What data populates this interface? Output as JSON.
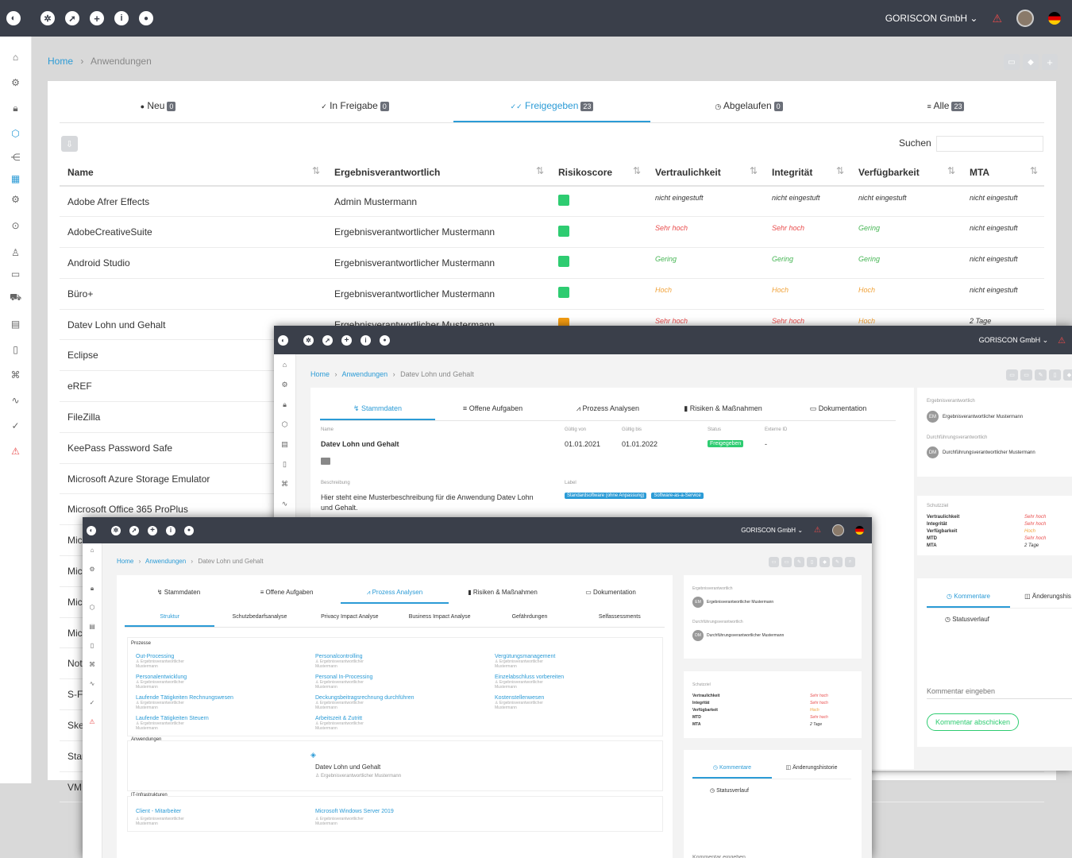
{
  "main": {
    "company": "GORISCON GmbH",
    "breadcrumb": {
      "home": "Home",
      "current": "Anwendungen"
    },
    "tabs": [
      {
        "label": "Neu",
        "count": "0"
      },
      {
        "label": "In Freigabe",
        "count": "0"
      },
      {
        "label": "Freigegeben",
        "count": "23"
      },
      {
        "label": "Abgelaufen",
        "count": "0"
      },
      {
        "label": "Alle",
        "count": "23"
      }
    ],
    "search_label": "Suchen",
    "columns": [
      "Name",
      "Ergebnisverantwortlich",
      "Risikoscore",
      "Vertraulichkeit",
      "Integrität",
      "Verfügbarkeit",
      "MTA"
    ],
    "rows": [
      {
        "name": "Adobe Afrer Effects",
        "owner": "Admin Mustermann",
        "risk": "#2ecc71",
        "v": "nicht eingestuft",
        "i": "nicht eingestuft",
        "a": "nicht eingestuft",
        "mta": "nicht eingestuft"
      },
      {
        "name": "AdobeCreativeSuite",
        "owner": "Ergebnisverantwortlicher Mustermann",
        "risk": "#2ecc71",
        "v": "Sehr hoch",
        "i": "Sehr hoch",
        "a": "Gering",
        "mta": "nicht eingestuft"
      },
      {
        "name": "Android Studio",
        "owner": "Ergebnisverantwortlicher Mustermann",
        "risk": "#2ecc71",
        "v": "Gering",
        "i": "Gering",
        "a": "Gering",
        "mta": "nicht eingestuft"
      },
      {
        "name": "Büro+",
        "owner": "Ergebnisverantwortlicher Mustermann",
        "risk": "#2ecc71",
        "v": "Hoch",
        "i": "Hoch",
        "a": "Hoch",
        "mta": "nicht eingestuft"
      },
      {
        "name": "Datev Lohn und Gehalt",
        "owner": "Ergebnisverantwortlicher Mustermann",
        "risk": "#f39c12",
        "v": "Sehr hoch",
        "i": "Sehr hoch",
        "a": "Hoch",
        "mta": "2 Tage"
      },
      {
        "name": "Eclipse"
      },
      {
        "name": "eREF"
      },
      {
        "name": "FileZilla"
      },
      {
        "name": "KeePass Password Safe"
      },
      {
        "name": "Microsoft Azure Storage Emulator"
      },
      {
        "name": "Microsoft Office 365 ProPlus"
      },
      {
        "name": "Mic"
      },
      {
        "name": "Mic"
      },
      {
        "name": "Mic"
      },
      {
        "name": "Mic"
      },
      {
        "name": "Not"
      },
      {
        "name": "S-F"
      },
      {
        "name": "Ske"
      },
      {
        "name": "Star"
      },
      {
        "name": "VM"
      }
    ],
    "footer_mta": "nicht eingestuft"
  },
  "detail": {
    "company": "GORISCON GmbH",
    "breadcrumb": {
      "home": "Home",
      "mid": "Anwendungen",
      "current": "Datev Lohn und Gehalt"
    },
    "tabs": [
      "Stammdaten",
      "Offene Aufgaben",
      "Prozess Analysen",
      "Risiken & Maßnahmen",
      "Dokumentation"
    ],
    "fields": {
      "name_label": "Name",
      "name": "Datev Lohn und Gehalt",
      "from_label": "Gültig von",
      "from": "01.01.2021",
      "to_label": "Gültig bis",
      "to": "01.01.2022",
      "status_label": "Status",
      "status": "Freigegeben",
      "ext_label": "Externe ID",
      "ext": "-",
      "desc_label": "Beschreibung",
      "desc": "Hier steht eine Musterbeschreibung für die Anwendung Datev Lohn und Gehalt.",
      "label_label": "Label",
      "tags": [
        "Standardsoftware (ohne Anpassung)",
        "Software-as-a-Service"
      ]
    },
    "right": {
      "owner_label": "Ergebnisverantwortlich",
      "owner_initials": "EM",
      "owner": "Ergebnisverantwortlicher Mustermann",
      "exec_label": "Durchführungsverantwortlich",
      "exec_initials": "DM",
      "exec": "Durchführungsverantwortlicher Mustermann"
    },
    "protect": {
      "label": "Schutzziel",
      "rows": [
        [
          "Vertraulichkeit",
          "Sehr hoch"
        ],
        [
          "Integrität",
          "Sehr hoch"
        ],
        [
          "Verfügbarkeit",
          "Hoch"
        ],
        [
          "MTD",
          "Sehr hoch"
        ],
        [
          "MTA",
          "2 Tage"
        ]
      ]
    },
    "comments": {
      "tab1": "Kommentare",
      "tab2": "Änderungshis",
      "status": "Statusverlauf",
      "placeholder": "Kommentar eingeben",
      "button": "Kommentar abschicken"
    }
  },
  "front": {
    "company": "GORISCON GmbH",
    "breadcrumb": {
      "home": "Home",
      "mid": "Anwendungen",
      "current": "Datev Lohn und Gehalt"
    },
    "tabs": [
      "Stammdaten",
      "Offene Aufgaben",
      "Prozess Analysen",
      "Risiken & Maßnahmen",
      "Dokumentation"
    ],
    "subtabs": [
      "Struktur",
      "Schutzbedarfsanalyse",
      "Privacy Impact Analyse",
      "Business Impact Analyse",
      "Gefährdungen",
      "Selfassessments"
    ],
    "processes_label": "Prozesse",
    "owner_line": "Ergebnisverantwortlicher Mustermann",
    "processes": [
      [
        "Out-Processing",
        "Personalcontrolling",
        "Vergütungsmanagement"
      ],
      [
        "Personalentwicklung",
        "Personal In-Processing",
        "Einzelabschluss vorbereiten"
      ],
      [
        "Laufende Tätigkeiten Rechnungswesen",
        "Deckungsbeitragsrechnung durchführen",
        "Kostenstellenwesen"
      ],
      [
        "Laufende Tätigkeiten Steuern",
        "Arbeitszeit & Zutritt",
        ""
      ]
    ],
    "apps_label": "Anwendungen",
    "app_name": "Datev Lohn und Gehalt",
    "app_owner": "Ergebnisverantwortlicher Mustermann",
    "it_label": "IT-Infrastrukturen",
    "it": [
      "Client - Mitarbeiter",
      "Microsoft Windows Server 2019"
    ],
    "right": {
      "owner_label": "Ergebnisverantwortlich",
      "owner_initials": "EM",
      "owner": "Ergebnisverantwortlicher Mustermann",
      "exec_label": "Durchführungsverantwortlich",
      "exec_initials": "DM",
      "exec": "Durchführungsverantwortlicher Mustermann"
    },
    "protect": {
      "label": "Schutzziel",
      "rows": [
        [
          "Vertraulichkeit",
          "Sehr hoch"
        ],
        [
          "Integrität",
          "Sehr hoch"
        ],
        [
          "Verfügbarkeit",
          "Hoch"
        ],
        [
          "MTD",
          "Sehr hoch"
        ],
        [
          "MTA",
          "2 Tage"
        ]
      ]
    },
    "comments": {
      "tab1": "Kommentare",
      "tab2": "Änderungshistorie",
      "status": "Statusverlauf",
      "placeholder": "Kommentar eingeben"
    }
  }
}
